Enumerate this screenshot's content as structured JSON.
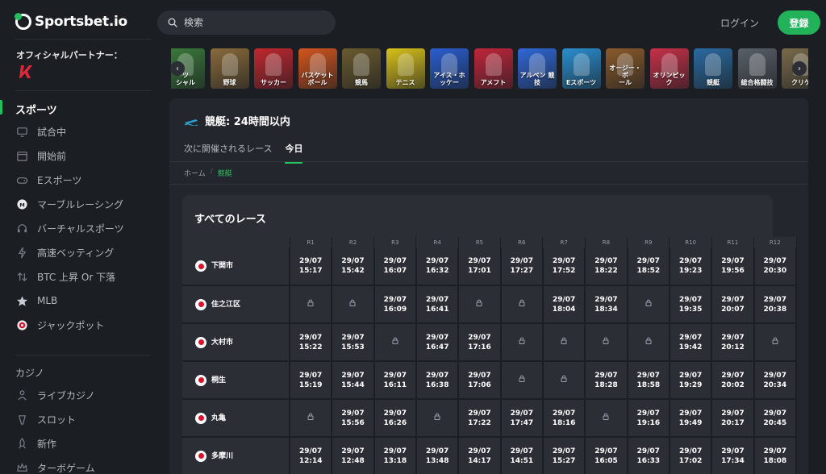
{
  "brand": {
    "name": "Sportsbet.io"
  },
  "sidebar": {
    "partner_label": "オフィシャルパートナー：",
    "sports_title": "スポーツ",
    "sports_items": [
      {
        "label": "試合中",
        "icon": "monitor-icon"
      },
      {
        "label": "開始前",
        "icon": "calendar-icon"
      },
      {
        "label": "Eスポーツ",
        "icon": "gamepad-icon"
      },
      {
        "label": "マーブルレーシング",
        "icon": "marble-icon"
      },
      {
        "label": "バーチャルスポーツ",
        "icon": "headset-icon"
      },
      {
        "label": "高速ベッティング",
        "icon": "lightning-icon"
      },
      {
        "label": "BTC 上昇 Or 下落",
        "icon": "arrows-updown-icon"
      },
      {
        "label": "MLB",
        "icon": "star-icon"
      },
      {
        "label": "ジャックポット",
        "icon": "target-icon"
      }
    ],
    "casino_title": "カジノ",
    "casino_items": [
      {
        "label": "ライブカジノ",
        "icon": "dealer-icon"
      },
      {
        "label": "スロット",
        "icon": "slot-icon"
      },
      {
        "label": "新作",
        "icon": "rocket-icon"
      },
      {
        "label": "ターボゲーム",
        "icon": "crown-icon"
      }
    ]
  },
  "header": {
    "search_placeholder": "検索",
    "login_label": "ログイン",
    "register_label": "登録"
  },
  "sports_carousel": [
    {
      "label": "ツ\nシャル",
      "color": "#3a7a3a"
    },
    {
      "label": "野球",
      "color": "#8a6a3a"
    },
    {
      "label": "サッカー",
      "color": "#c0282e"
    },
    {
      "label": "バスケット\nボール",
      "color": "#d2551e"
    },
    {
      "label": "競馬",
      "color": "#6a5a2e"
    },
    {
      "label": "テニス",
      "color": "#d9c21a"
    },
    {
      "label": "アイス・ホ\nッケー",
      "color": "#2a5ed0"
    },
    {
      "label": "アメフト",
      "color": "#c2253a"
    },
    {
      "label": "アルペン 競\n技",
      "color": "#2f68d8"
    },
    {
      "label": "Eスポーツ",
      "color": "#2a8fd0"
    },
    {
      "label": "オージー・ボ\nール",
      "color": "#8a5a2a"
    },
    {
      "label": "オリンピッ\nク",
      "color": "#c83048"
    },
    {
      "label": "競艇",
      "color": "#2a6aa0"
    },
    {
      "label": "総合格闘技",
      "color": "#5a6068"
    },
    {
      "label": "クリケ",
      "color": "#7a6a4a"
    }
  ],
  "page": {
    "title": "競艇: 24時間以内",
    "tabs": [
      "次に開催されるレース",
      "今日"
    ],
    "active_tab": "今日",
    "breadcrumb": [
      "ホーム",
      "競艇"
    ],
    "all_races_title": "すべてのレース"
  },
  "race_table": {
    "columns": [
      "R1",
      "R2",
      "R3",
      "R4",
      "R5",
      "R6",
      "R7",
      "R8",
      "R9",
      "R10",
      "R11",
      "R12"
    ],
    "rows": [
      {
        "venue": "下関市",
        "times": [
          "29/07\n15:17",
          "29/07\n15:42",
          "29/07\n16:07",
          "29/07\n16:32",
          "29/07\n17:01",
          "29/07\n17:27",
          "29/07\n17:52",
          "29/07\n18:22",
          "29/07\n18:52",
          "29/07\n19:23",
          "29/07\n19:56",
          "29/07\n20:30"
        ]
      },
      {
        "venue": "住之江区",
        "times": [
          "lock",
          "lock",
          "29/07\n16:09",
          "29/07\n16:41",
          "lock",
          "lock",
          "29/07\n18:04",
          "29/07\n18:34",
          "lock",
          "29/07\n19:35",
          "29/07\n20:07",
          "29/07\n20:38"
        ]
      },
      {
        "venue": "大村市",
        "times": [
          "29/07\n15:22",
          "29/07\n15:53",
          "lock",
          "29/07\n16:47",
          "29/07\n17:16",
          "lock",
          "lock",
          "lock",
          "lock",
          "29/07\n19:42",
          "29/07\n20:12",
          "lock"
        ]
      },
      {
        "venue": "桐生",
        "times": [
          "29/07\n15:19",
          "29/07\n15:44",
          "29/07\n16:11",
          "29/07\n16:38",
          "29/07\n17:06",
          "lock",
          "lock",
          "29/07\n18:28",
          "29/07\n18:58",
          "29/07\n19:29",
          "29/07\n20:02",
          "29/07\n20:34"
        ]
      },
      {
        "venue": "丸亀",
        "times": [
          "lock",
          "29/07\n15:56",
          "29/07\n16:26",
          "lock",
          "29/07\n17:22",
          "29/07\n17:47",
          "29/07\n18:16",
          "lock",
          "29/07\n19:16",
          "29/07\n19:49",
          "29/07\n20:17",
          "29/07\n20:45"
        ]
      },
      {
        "venue": "多摩川",
        "times": [
          "29/07\n12:14",
          "29/07\n12:48",
          "29/07\n13:18",
          "29/07\n13:48",
          "29/07\n14:17",
          "29/07\n14:51",
          "29/07\n15:27",
          "29/07\n16:05",
          "29/07\n16:33",
          "29/07\n17:02",
          "29/07\n17:34",
          "29/07\n18:08"
        ]
      }
    ]
  },
  "colors": {
    "accent": "#21c25e",
    "background": "#1b1e22",
    "panel": "#23272d",
    "cell": "#2b2f35"
  }
}
